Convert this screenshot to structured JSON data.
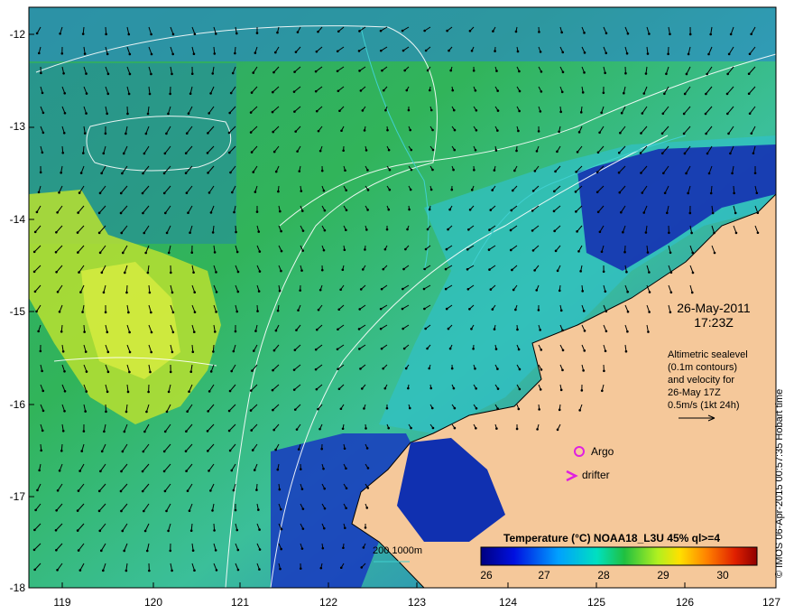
{
  "map": {
    "y_labels": [
      "-12",
      "-13",
      "-14",
      "-15",
      "-16",
      "-17",
      "-18"
    ],
    "x_labels": [
      "119",
      "120",
      "121",
      "122",
      "123",
      "124",
      "125",
      "126",
      "127"
    ],
    "date_line1": "26-May-2011",
    "date_line2": "17:23Z",
    "altimetric": [
      "Altimetric sealevel",
      "(0.1m contours)",
      "and velocity for",
      "26-May 17Z",
      "0.5m/s (1kt 24h)"
    ],
    "legend_title": "Temperature (°C) NOAA18_L3U 45% ql>=4",
    "legend_ticks": [
      "26",
      "27",
      "28",
      "29",
      "30"
    ],
    "argo_label": "Argo",
    "drifter_label": "drifter",
    "depth_scale_label": "200  1000m",
    "credit": "© IMOS 06-Apr-2015 00:57:35 Hobart time",
    "colors": {
      "land": "#f5c89a",
      "markers": "#e020e0",
      "depth_line": "#40d0d0",
      "sea_cool": "#1030c0",
      "sea_mid": "#2bb0e0",
      "sea_warm": "#28b848",
      "sea_hot": "#d4e830"
    }
  }
}
